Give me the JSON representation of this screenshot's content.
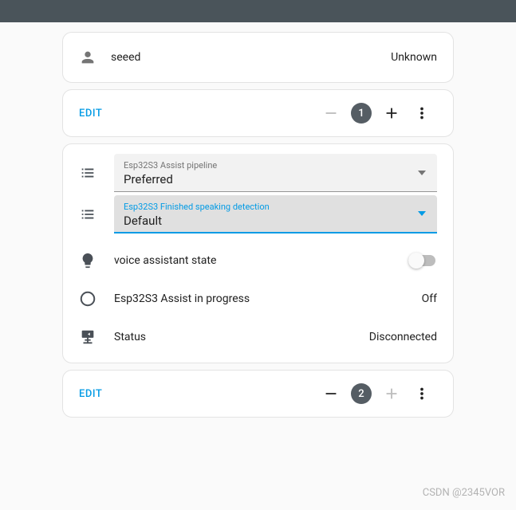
{
  "colors": {
    "accent": "#039be5",
    "badge": "#555d64"
  },
  "card1": {
    "name": "seeed",
    "status": "Unknown",
    "edit": "EDIT",
    "count": "1"
  },
  "card2": {
    "selects": [
      {
        "label": "Esp32S3 Assist pipeline",
        "value": "Preferred",
        "active": false
      },
      {
        "label": "Esp32S3 Finished speaking detection",
        "value": "Default",
        "active": true
      }
    ],
    "rows": [
      {
        "icon": "lightbulb",
        "label": "voice assistant state",
        "control": "toggle",
        "on": false
      },
      {
        "icon": "circle-outline",
        "label": "Esp32S3 Assist in progress",
        "value": "Off"
      },
      {
        "icon": "server-network-off",
        "label": "Status",
        "value": "Disconnected"
      }
    ]
  },
  "card3": {
    "edit": "EDIT",
    "count": "2"
  },
  "watermark": "CSDN @2345VOR"
}
